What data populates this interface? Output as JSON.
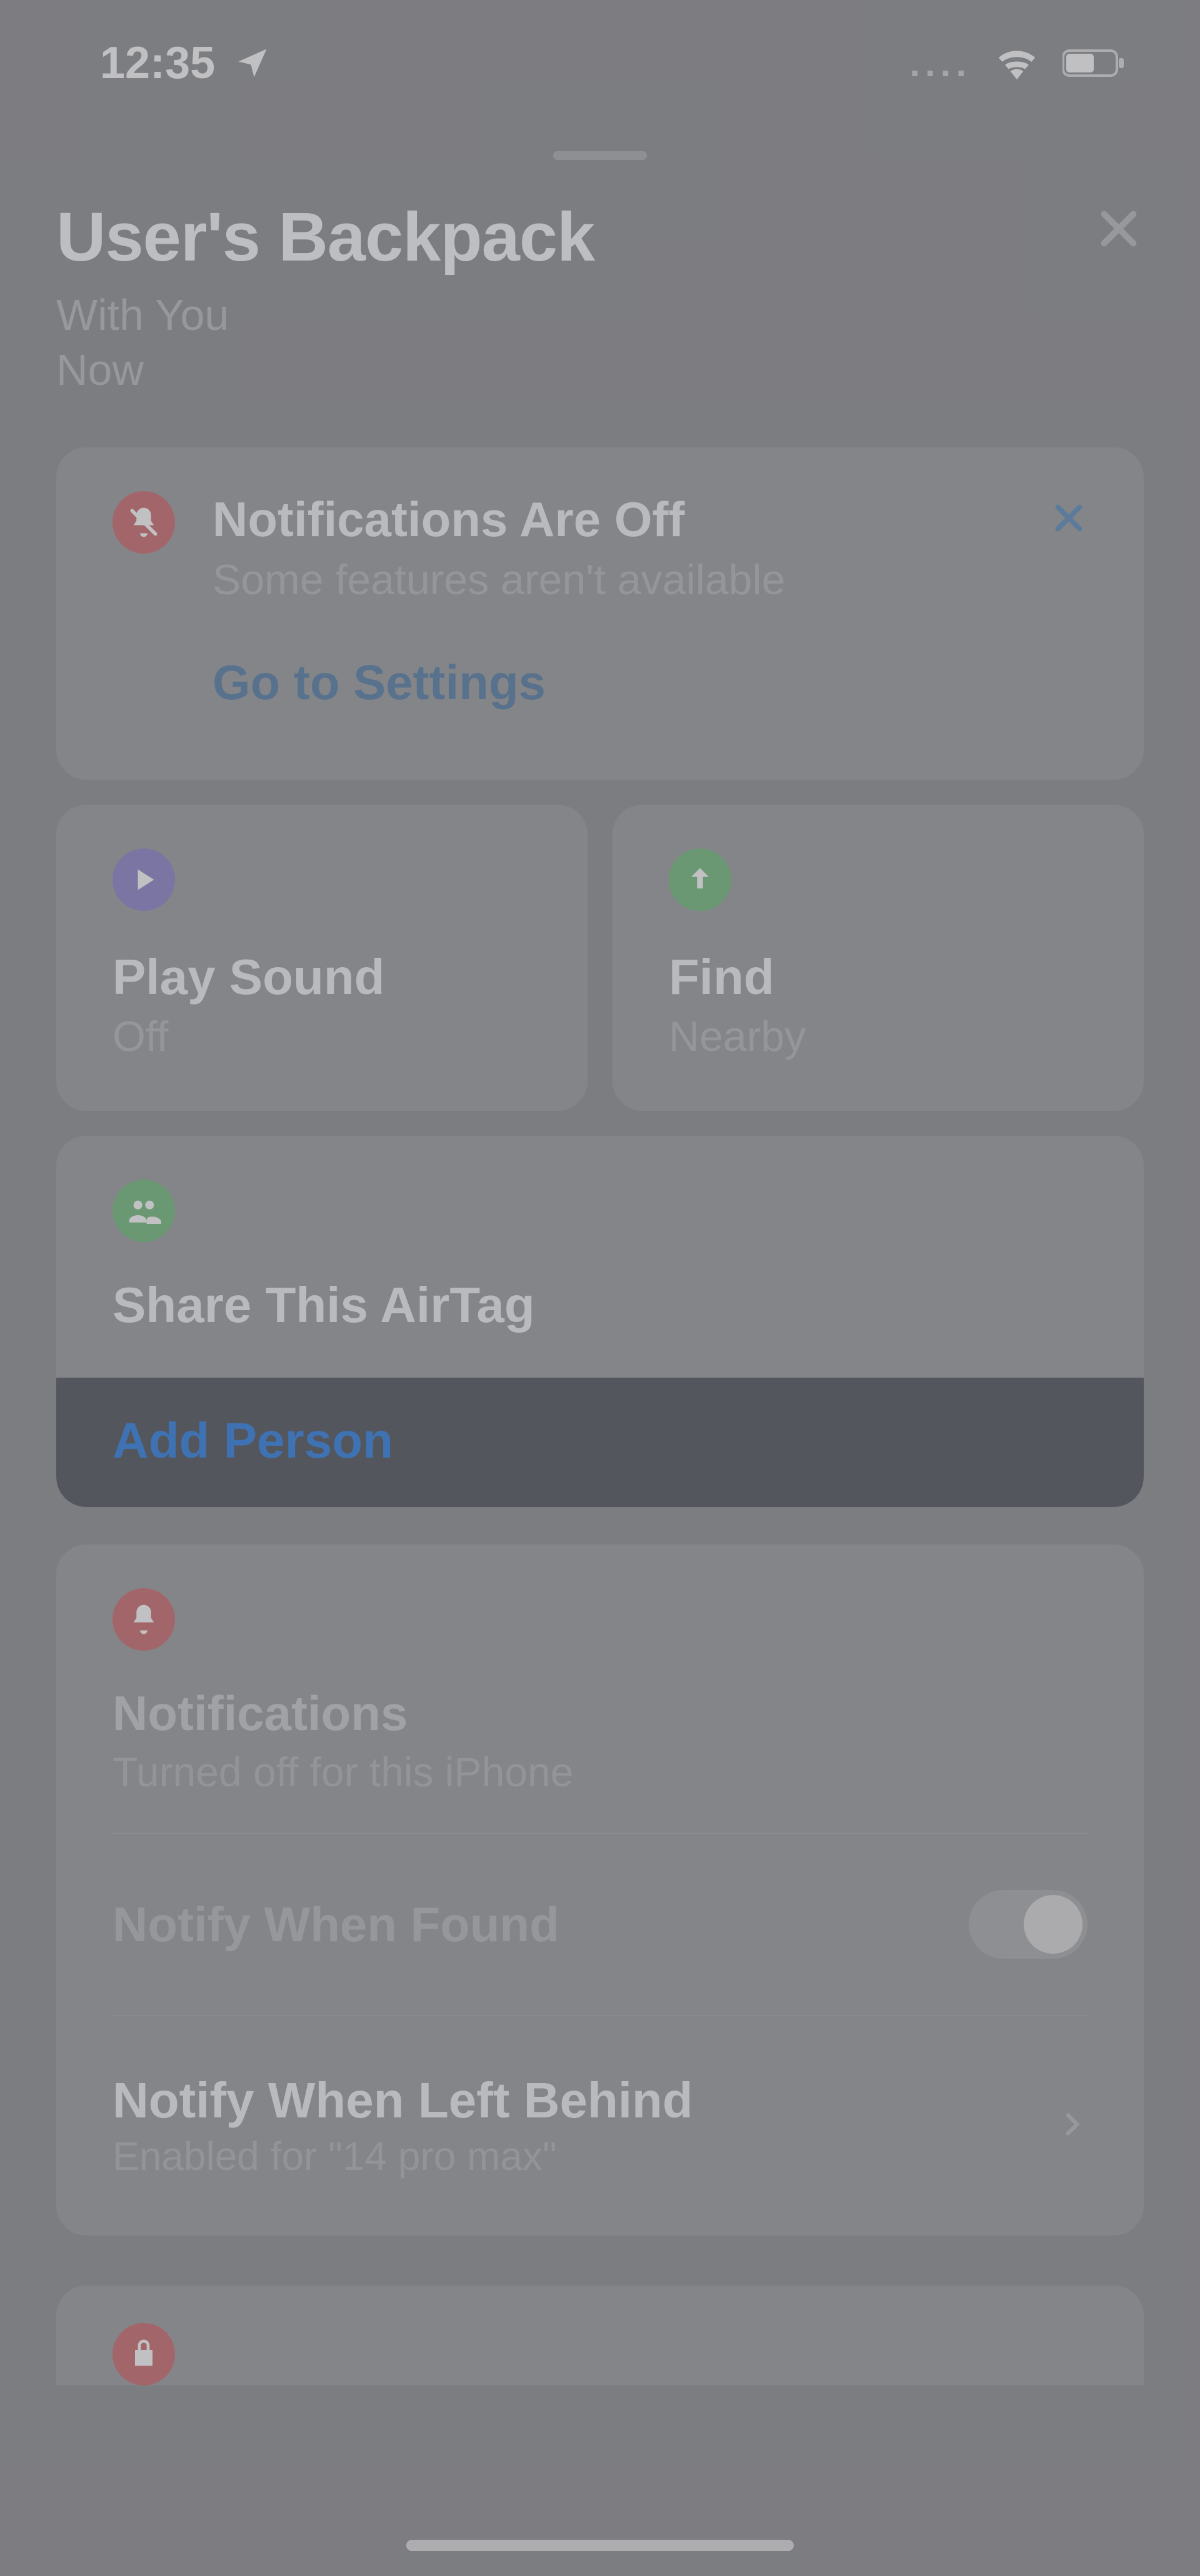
{
  "status": {
    "time": "12:35",
    "signal_dots": "....",
    "wifi": "wifi",
    "battery_pct": 55
  },
  "header": {
    "title": "User's Backpack",
    "subtitle_line1": "With You",
    "subtitle_line2": "Now"
  },
  "banner": {
    "title": "Notifications Are Off",
    "subtitle": "Some features aren't available",
    "cta": "Go to Settings"
  },
  "actions": {
    "play": {
      "label": "Play Sound",
      "sub": "Off"
    },
    "find": {
      "label": "Find",
      "sub": "Nearby"
    }
  },
  "share": {
    "title": "Share This AirTag",
    "add": "Add Person"
  },
  "notifications_section": {
    "title": "Notifications",
    "subtitle": "Turned off for this iPhone",
    "found_row": "Notify When Found",
    "left_row": {
      "title": "Notify When Left Behind",
      "sub": "Enabled for \"14 pro max\""
    }
  },
  "colors": {
    "accent_blue": "#1f6fd0",
    "link_blue": "#476f97",
    "red": "#b85c61",
    "green": "#63a96f",
    "purple": "#7b74b7"
  }
}
